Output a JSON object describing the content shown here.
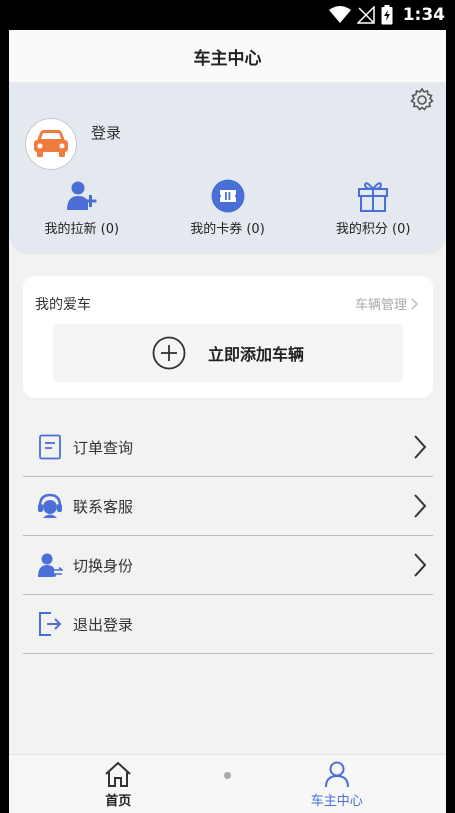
{
  "status_bar": {
    "time": "1:34"
  },
  "header": {
    "title": "车主中心"
  },
  "profile": {
    "login_label": "登录",
    "stats": [
      {
        "label": "我的拉新 (0)",
        "icon": "user-add-icon"
      },
      {
        "label": "我的卡券 (0)",
        "icon": "coupon-icon"
      },
      {
        "label": "我的积分 (0)",
        "icon": "gift-icon"
      }
    ]
  },
  "car_section": {
    "title": "我的爱车",
    "manage_label": "车辆管理",
    "add_label": "立即添加车辆"
  },
  "menu": [
    {
      "label": "订单查询",
      "icon": "order-icon",
      "chevron": true
    },
    {
      "label": "联系客服",
      "icon": "customer-service-icon",
      "chevron": true
    },
    {
      "label": "切换身份",
      "icon": "switch-user-icon",
      "chevron": true
    },
    {
      "label": "退出登录",
      "icon": "logout-icon",
      "chevron": false
    }
  ],
  "tabbar": {
    "tabs": [
      {
        "label": "首页",
        "active": false
      },
      {
        "label": "车主中心",
        "active": true
      }
    ]
  },
  "colors": {
    "accent": "#4a6fd6",
    "avatar_car": "#f07b3f",
    "card_bg": "#e4e9f0",
    "page_bg": "#f2f2f2"
  }
}
